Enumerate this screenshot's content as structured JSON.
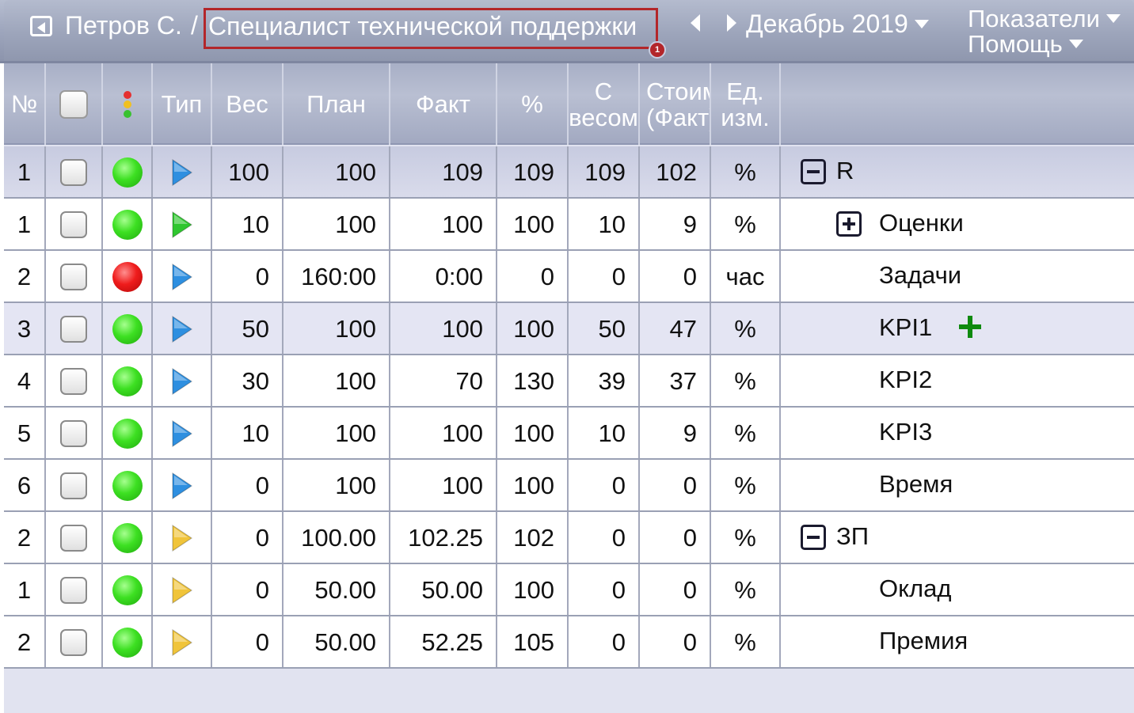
{
  "header": {
    "user": "Петров С.",
    "separator": "/",
    "position_title": "Специалист технической поддержки",
    "badge_count": "1",
    "period": "Декабрь 2019",
    "menu_indicators": "Показатели",
    "menu_help": "Помощь"
  },
  "columns": {
    "no": "№",
    "type": "Тип",
    "weight": "Вес",
    "plan": "План",
    "fact": "Факт",
    "percent": "%",
    "weighted_l1": "С",
    "weighted_l2": "весом",
    "cost_l1": "Стоимость",
    "cost_l2": "(Факт)",
    "unit_l1": "Ед.",
    "unit_l2": "изм."
  },
  "colors": {
    "header_bg": "#9ea6bd",
    "highlight_border": "#b3262a",
    "status_green": "#3de022",
    "status_red": "#ef1c1c",
    "type_blue": "#2e8fe0",
    "type_green": "#2fc62f",
    "type_yellow": "#f0c43a",
    "add_green": "#0f8a0f"
  },
  "rows": [
    {
      "no": "1",
      "status": "green",
      "type": "blue",
      "weight": "100",
      "plan": "100",
      "fact": "109",
      "pct": "109",
      "weighted": "109",
      "cost": "102",
      "unit": "%",
      "name": "R",
      "level": 0,
      "toggle": "minus",
      "style": "first"
    },
    {
      "no": "1",
      "status": "green",
      "type": "green",
      "weight": "10",
      "plan": "100",
      "fact": "100",
      "pct": "100",
      "weighted": "10",
      "cost": "9",
      "unit": "%",
      "name": "Оценки",
      "level": 1,
      "toggle": "plus",
      "style": "w"
    },
    {
      "no": "2",
      "status": "red",
      "type": "blue",
      "weight": "0",
      "plan": "160:00",
      "fact": "0:00",
      "pct": "0",
      "weighted": "0",
      "cost": "0",
      "unit": "час",
      "name": "Задачи",
      "level": 1,
      "toggle": "",
      "style": "w"
    },
    {
      "no": "3",
      "status": "green",
      "type": "blue",
      "weight": "50",
      "plan": "100",
      "fact": "100",
      "pct": "100",
      "weighted": "50",
      "cost": "47",
      "unit": "%",
      "name": "KPI1",
      "level": 1,
      "toggle": "",
      "style": "s",
      "add": true
    },
    {
      "no": "4",
      "status": "green",
      "type": "blue",
      "weight": "30",
      "plan": "100",
      "fact": "70",
      "pct": "130",
      "weighted": "39",
      "cost": "37",
      "unit": "%",
      "name": "KPI2",
      "level": 1,
      "toggle": "",
      "style": "w"
    },
    {
      "no": "5",
      "status": "green",
      "type": "blue",
      "weight": "10",
      "plan": "100",
      "fact": "100",
      "pct": "100",
      "weighted": "10",
      "cost": "9",
      "unit": "%",
      "name": "KPI3",
      "level": 1,
      "toggle": "",
      "style": "w"
    },
    {
      "no": "6",
      "status": "green",
      "type": "blue",
      "weight": "0",
      "plan": "100",
      "fact": "100",
      "pct": "100",
      "weighted": "0",
      "cost": "0",
      "unit": "%",
      "name": "Время",
      "level": 1,
      "toggle": "",
      "style": "w"
    },
    {
      "no": "2",
      "status": "green",
      "type": "yellow",
      "weight": "0",
      "plan": "100.00",
      "fact": "102.25",
      "pct": "102",
      "weighted": "0",
      "cost": "0",
      "unit": "%",
      "name": "ЗП",
      "level": 0,
      "toggle": "minus",
      "style": "w"
    },
    {
      "no": "1",
      "status": "green",
      "type": "yellow",
      "weight": "0",
      "plan": "50.00",
      "fact": "50.00",
      "pct": "100",
      "weighted": "0",
      "cost": "0",
      "unit": "%",
      "name": "Оклад",
      "level": 1,
      "toggle": "",
      "style": "w"
    },
    {
      "no": "2",
      "status": "green",
      "type": "yellow",
      "weight": "0",
      "plan": "50.00",
      "fact": "52.25",
      "pct": "105",
      "weighted": "0",
      "cost": "0",
      "unit": "%",
      "name": "Премия",
      "level": 1,
      "toggle": "",
      "style": "w"
    }
  ]
}
